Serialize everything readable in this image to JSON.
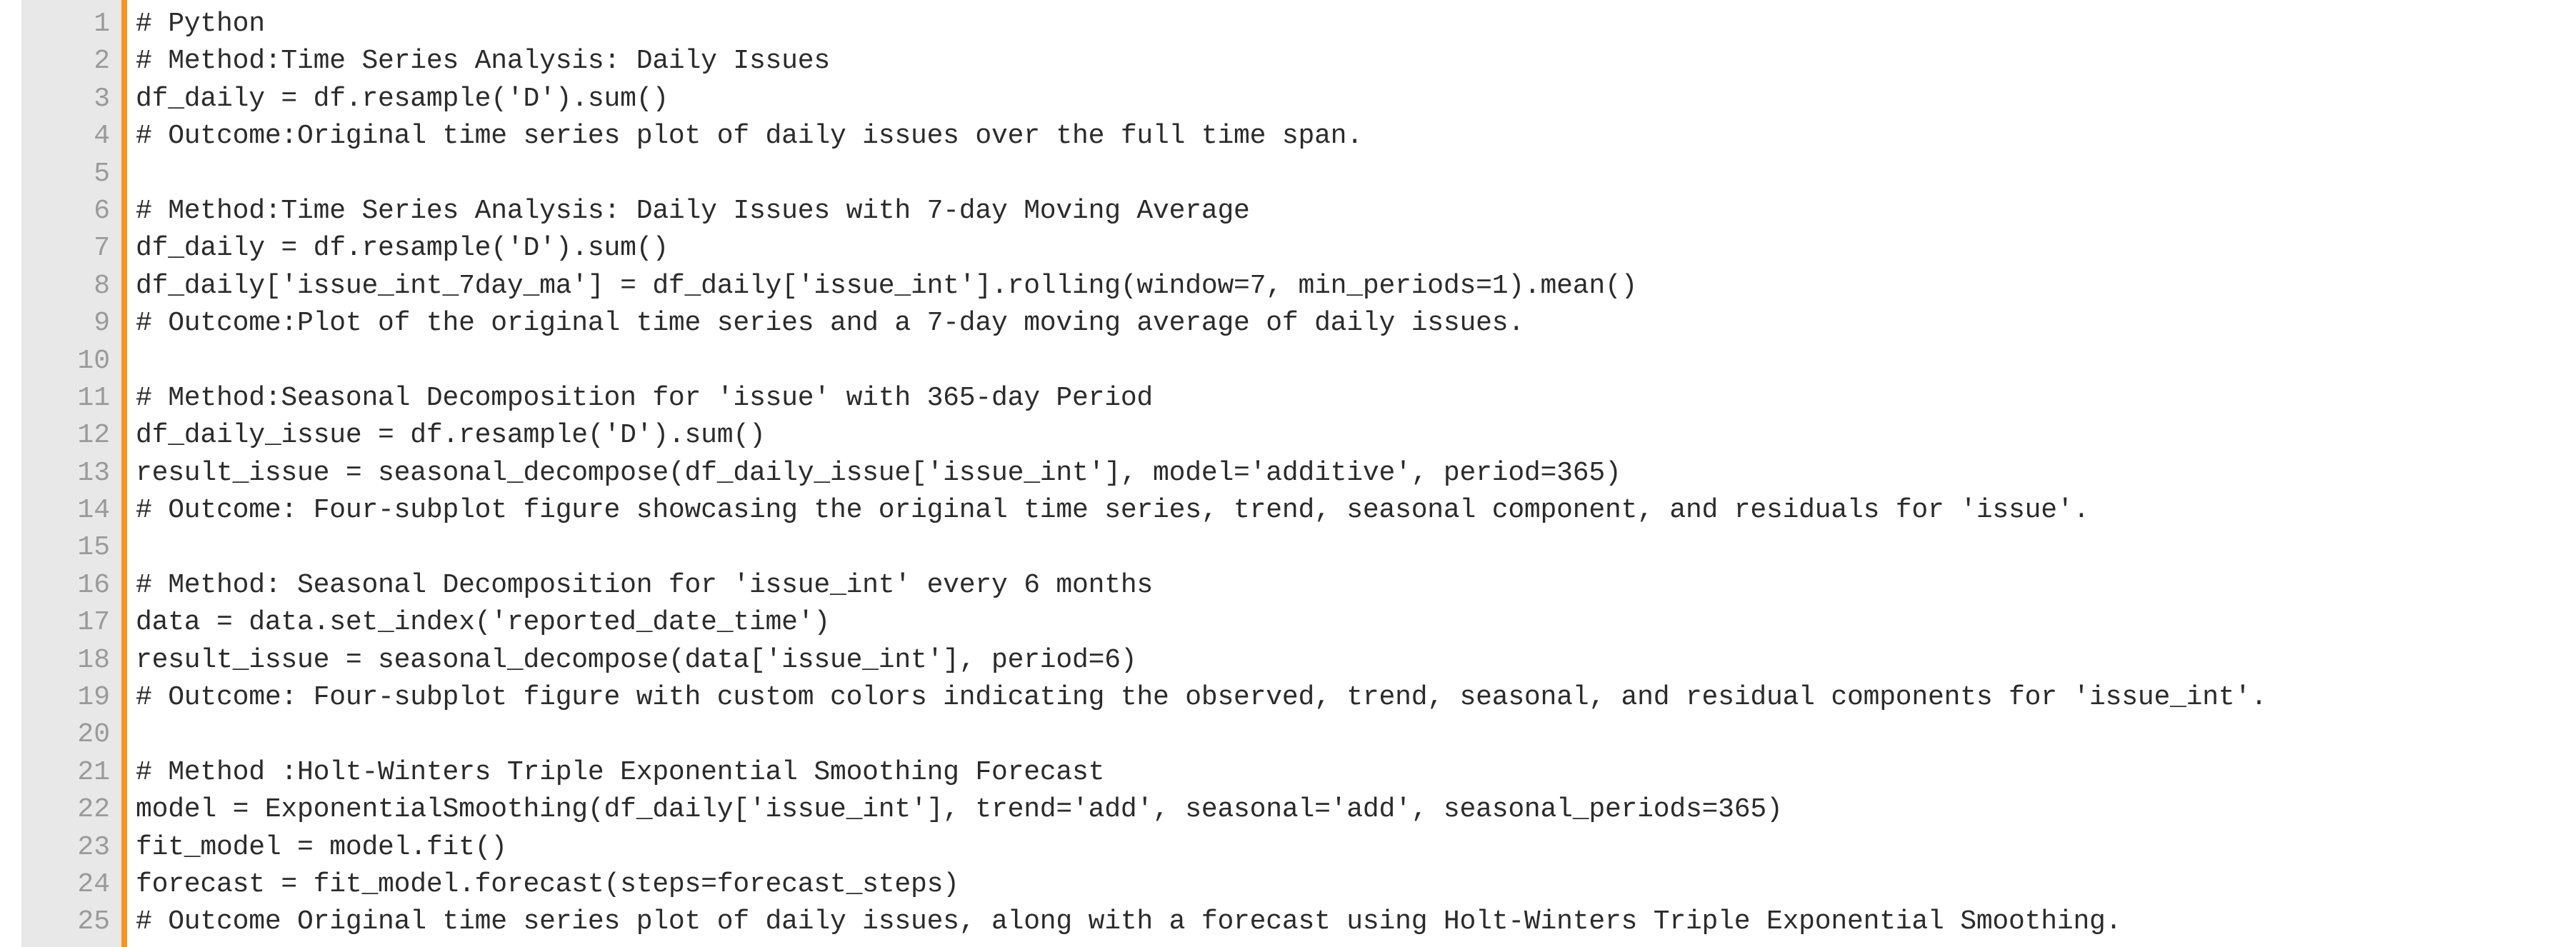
{
  "editor": {
    "language_label": "Python",
    "accent_color": "#f7941e",
    "gutter_background": "#e8e8e8",
    "code_background": "#ffffff",
    "line_number_color": "#9a9a9a",
    "code_text_color": "#2b2b2b",
    "total_lines": 25
  },
  "code": {
    "line_numbers": [
      "1",
      "2",
      "3",
      "4",
      "5",
      "6",
      "7",
      "8",
      "9",
      "10",
      "11",
      "12",
      "13",
      "14",
      "15",
      "16",
      "17",
      "18",
      "19",
      "20",
      "21",
      "22",
      "23",
      "24",
      "25"
    ],
    "lines": [
      "# Python",
      "# Method:Time Series Analysis: Daily Issues",
      "df_daily = df.resample('D').sum()",
      "# Outcome:Original time series plot of daily issues over the full time span.",
      "",
      "# Method:Time Series Analysis: Daily Issues with 7-day Moving Average",
      "df_daily = df.resample('D').sum()",
      "df_daily['issue_int_7day_ma'] = df_daily['issue_int'].rolling(window=7, min_periods=1).mean()",
      "# Outcome:Plot of the original time series and a 7-day moving average of daily issues.",
      "",
      "# Method:Seasonal Decomposition for 'issue' with 365-day Period",
      "df_daily_issue = df.resample('D').sum()",
      "result_issue = seasonal_decompose(df_daily_issue['issue_int'], model='additive', period=365)",
      "# Outcome: Four-subplot figure showcasing the original time series, trend, seasonal component, and residuals for 'issue'.",
      "",
      "# Method: Seasonal Decomposition for 'issue_int' every 6 months",
      "data = data.set_index('reported_date_time')",
      "result_issue = seasonal_decompose(data['issue_int'], period=6)",
      "# Outcome: Four-subplot figure with custom colors indicating the observed, trend, seasonal, and residual components for 'issue_int'.",
      "",
      "# Method :Holt-Winters Triple Exponential Smoothing Forecast",
      "model = ExponentialSmoothing(df_daily['issue_int'], trend='add', seasonal='add', seasonal_periods=365)",
      "fit_model = model.fit()",
      "forecast = fit_model.forecast(steps=forecast_steps)",
      "# Outcome Original time series plot of daily issues, along with a forecast using Holt-Winters Triple Exponential Smoothing."
    ]
  }
}
